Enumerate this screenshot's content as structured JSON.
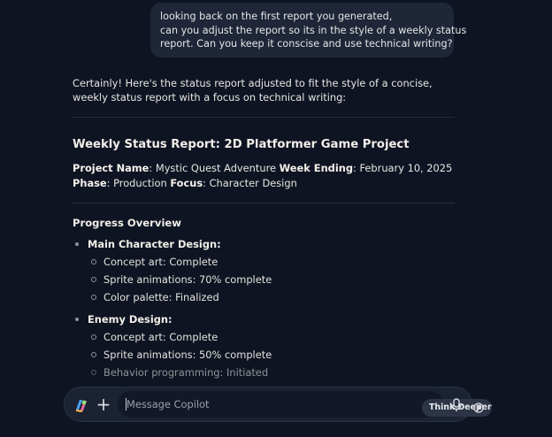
{
  "user_message": {
    "lines": [
      "looking back on the first report you generated,",
      "can you adjust the report so its in the style of a weekly status",
      "report. Can you keep it conscise and use technical writing?"
    ]
  },
  "response": {
    "intro": "Certainly! Here's the status report adjusted to fit the style of a concise, weekly status report with a focus on technical writing:",
    "title": "Weekly Status Report: 2D Platformer Game Project",
    "meta": {
      "project_name_label": "Project Name",
      "project_name_value": ": Mystic Quest Adventure ",
      "week_ending_label": "Week Ending",
      "week_ending_value": ": February 10, 2025 ",
      "phase_label": "Phase",
      "phase_value": ": Production ",
      "focus_label": "Focus",
      "focus_value": ": Character Design"
    },
    "section_heading": "Progress Overview",
    "groups": [
      {
        "title": "Main Character Design:",
        "items": [
          "Concept art: Complete",
          "Sprite animations: 70% complete",
          "Color palette: Finalized"
        ]
      },
      {
        "title": "Enemy Design:",
        "items": [
          "Concept art: Complete",
          "Sprite animations: 50% complete",
          "Behavior programming: Initiated"
        ]
      }
    ]
  },
  "composer": {
    "placeholder": "Message Copilot",
    "value": "",
    "think_deeper_label": "Think Deeper",
    "icons": [
      "copilot-logo-icon",
      "plus-icon",
      "think-deeper-icon",
      "microphone-icon"
    ]
  }
}
